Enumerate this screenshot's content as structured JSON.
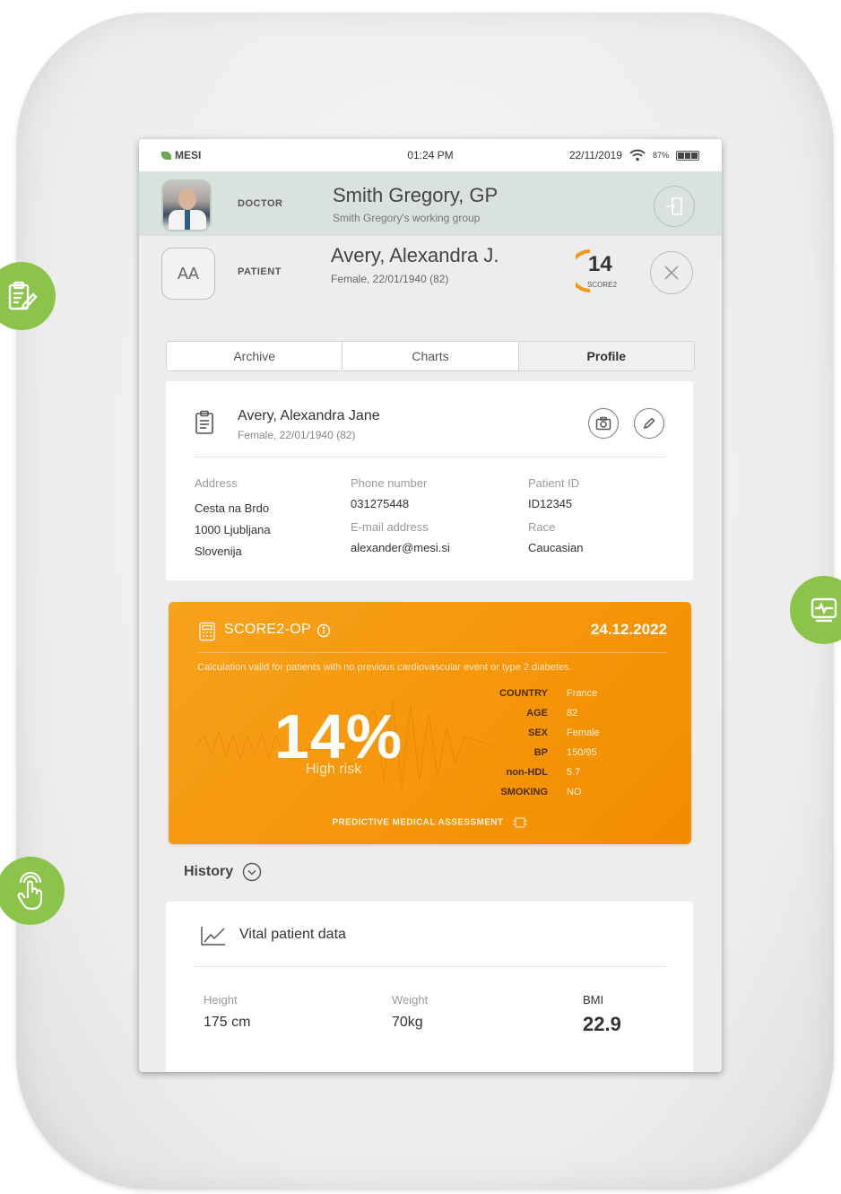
{
  "status_bar": {
    "brand": "MESI",
    "time": "01:24 PM",
    "date": "22/11/2019",
    "battery": "87%"
  },
  "doctor": {
    "role": "DOCTOR",
    "name": "Smith Gregory, GP",
    "group": "Smith Gregory's working group"
  },
  "patient": {
    "initials": "AA",
    "role": "PATIENT",
    "name": "Avery, Alexandra J.",
    "info": "Female, 22/01/1940  (82)"
  },
  "score_badge": {
    "value": "14",
    "label": "SCORE2"
  },
  "tabs": [
    {
      "label": "Archive"
    },
    {
      "label": "Charts"
    },
    {
      "label": "Profile"
    }
  ],
  "profile": {
    "full_name": "Avery, Alexandra Jane",
    "info": "Female, 22/01/1940  (82)",
    "address_label": "Address",
    "address_lines": [
      "Cesta na Brdo",
      "1000 Ljubljana",
      "Slovenija"
    ],
    "phone_label": "Phone number",
    "phone": "031275448",
    "email_label": "E-mail address",
    "email": "alexander@mesi.si",
    "patient_id_label": "Patient ID",
    "patient_id": "ID12345",
    "race_label": "Race",
    "race": "Caucasian"
  },
  "score_card": {
    "title": "SCORE2-OP",
    "date": "24.12.2022",
    "note": "Calculation valid for patients with no previous cardiovascular event or type 2 diabetes.",
    "percent": "14%",
    "risk": "High risk",
    "params": [
      {
        "key": "COUNTRY",
        "value": "France"
      },
      {
        "key": "AGE",
        "value": "82"
      },
      {
        "key": "SEX",
        "value": "Female"
      },
      {
        "key": "BP",
        "value": "150/95"
      },
      {
        "key": "non-HDL",
        "value": "5.7"
      },
      {
        "key": "SMOKING",
        "value": "NO"
      }
    ],
    "footer": "PREDICTIVE MEDICAL ASSESSMENT",
    "accent_color": "#f6960a"
  },
  "history": {
    "label": "History"
  },
  "vitals": {
    "title": "Vital patient data",
    "height_label": "Height",
    "height": "175 cm",
    "weight_label": "Weight",
    "weight": "70kg",
    "bmi_label": "BMI",
    "bmi": "22.9"
  },
  "side_icons": [
    "clipboard-edit-icon",
    "monitor-ecg-icon",
    "touch-hand-icon"
  ],
  "colors": {
    "doctor_bar": "#d9e2dc",
    "side_button": "#8cc34a",
    "score_orange": "#f6960a"
  }
}
